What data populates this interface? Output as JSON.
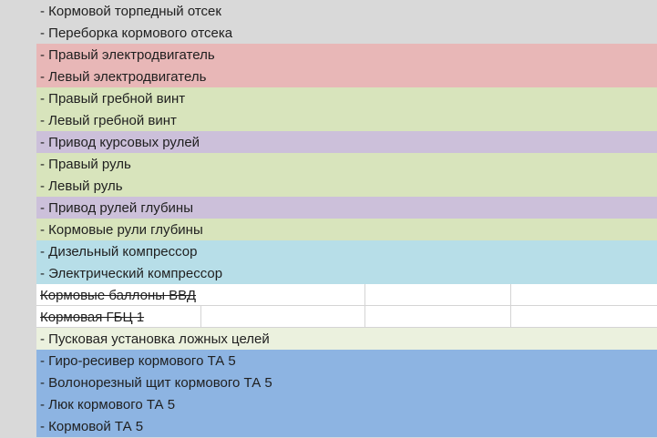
{
  "colors": {
    "grey": "#d9d9d9",
    "red": "#e8b7b7",
    "green": "#d8e4bc",
    "purple": "#ccc0da",
    "cyan": "#b7dee8",
    "white": "#ffffff",
    "cream": "#ebf1de",
    "blue": "#8db4e2"
  },
  "rows": [
    {
      "text": "- Кормовой торпедный отсек",
      "color": "grey",
      "struck": false
    },
    {
      "text": "- Переборка кормового отсека",
      "color": "grey",
      "struck": false
    },
    {
      "text": "- Правый электродвигатель",
      "color": "red",
      "struck": false
    },
    {
      "text": "- Левый электродвигатель",
      "color": "red",
      "struck": false
    },
    {
      "text": "- Правый гребной винт",
      "color": "green",
      "struck": false
    },
    {
      "text": "- Левый гребной винт",
      "color": "green",
      "struck": false
    },
    {
      "text": "- Привод курсовых рулей",
      "color": "purple",
      "struck": false
    },
    {
      "text": "- Правый руль",
      "color": "green",
      "struck": false
    },
    {
      "text": "- Левый руль",
      "color": "green",
      "struck": false
    },
    {
      "text": "- Привод рулей глубины",
      "color": "purple",
      "struck": false
    },
    {
      "text": "- Кормовые рули глубины",
      "color": "green",
      "struck": false
    },
    {
      "text": "- Дизельный компрессор",
      "color": "cyan",
      "struck": false
    },
    {
      "text": "- Электрический компрессор",
      "color": "cyan",
      "struck": false
    },
    {
      "text": " Кормовые баллоны ВВД",
      "color": "white",
      "struck": true
    },
    {
      "text": " Кормовая ГБЦ 1",
      "color": "white",
      "struck": true
    },
    {
      "text": "- Пусковая установка ложных целей",
      "color": "cream",
      "struck": false
    },
    {
      "text": "- Гиро-ресивер кормового ТА 5",
      "color": "blue",
      "struck": false
    },
    {
      "text": "- Волонорезный щит кормового ТА 5",
      "color": "blue",
      "struck": false
    },
    {
      "text": "- Люк кормового ТА 5",
      "color": "blue",
      "struck": false
    },
    {
      "text": "- Кормовой ТА 5",
      "color": "blue",
      "struck": false
    }
  ]
}
